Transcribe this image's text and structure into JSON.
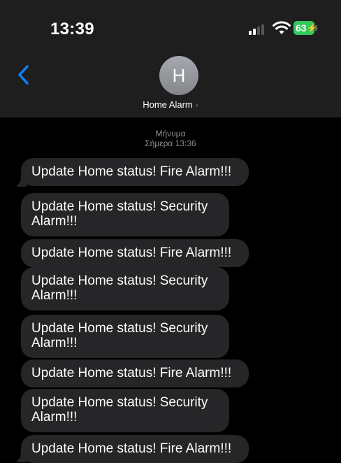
{
  "status_bar": {
    "time": "13:39",
    "battery_level": "63",
    "icons": [
      "cellular-signal-icon",
      "wifi-icon",
      "battery-charging-icon"
    ]
  },
  "header": {
    "back_icon": "chevron-left-icon",
    "avatar_initial": "H",
    "contact_name": "Home Alarm",
    "chevron": "›"
  },
  "thread_meta": {
    "label": "Μήνυμα",
    "timestamp": "Σήμερα 13:36"
  },
  "colors": {
    "background": "#000000",
    "header": "#1e1e1f",
    "bubble": "#262628",
    "accent": "#0a84ff",
    "battery": "#34c759"
  },
  "messages": [
    {
      "text": "Update Home status! Fire Alarm!!!"
    },
    {
      "text": "Update Home status! Security Alarm!!!"
    },
    {
      "text": "Update Home status! Fire Alarm!!!"
    },
    {
      "text": "Update Home status! Security Alarm!!!"
    },
    {
      "text": "Update Home status! Security Alarm!!!"
    },
    {
      "text": "Update Home status! Fire Alarm!!!"
    },
    {
      "text": "Update Home status! Security Alarm!!!"
    },
    {
      "text": "Update Home status! Fire Alarm!!!"
    }
  ]
}
